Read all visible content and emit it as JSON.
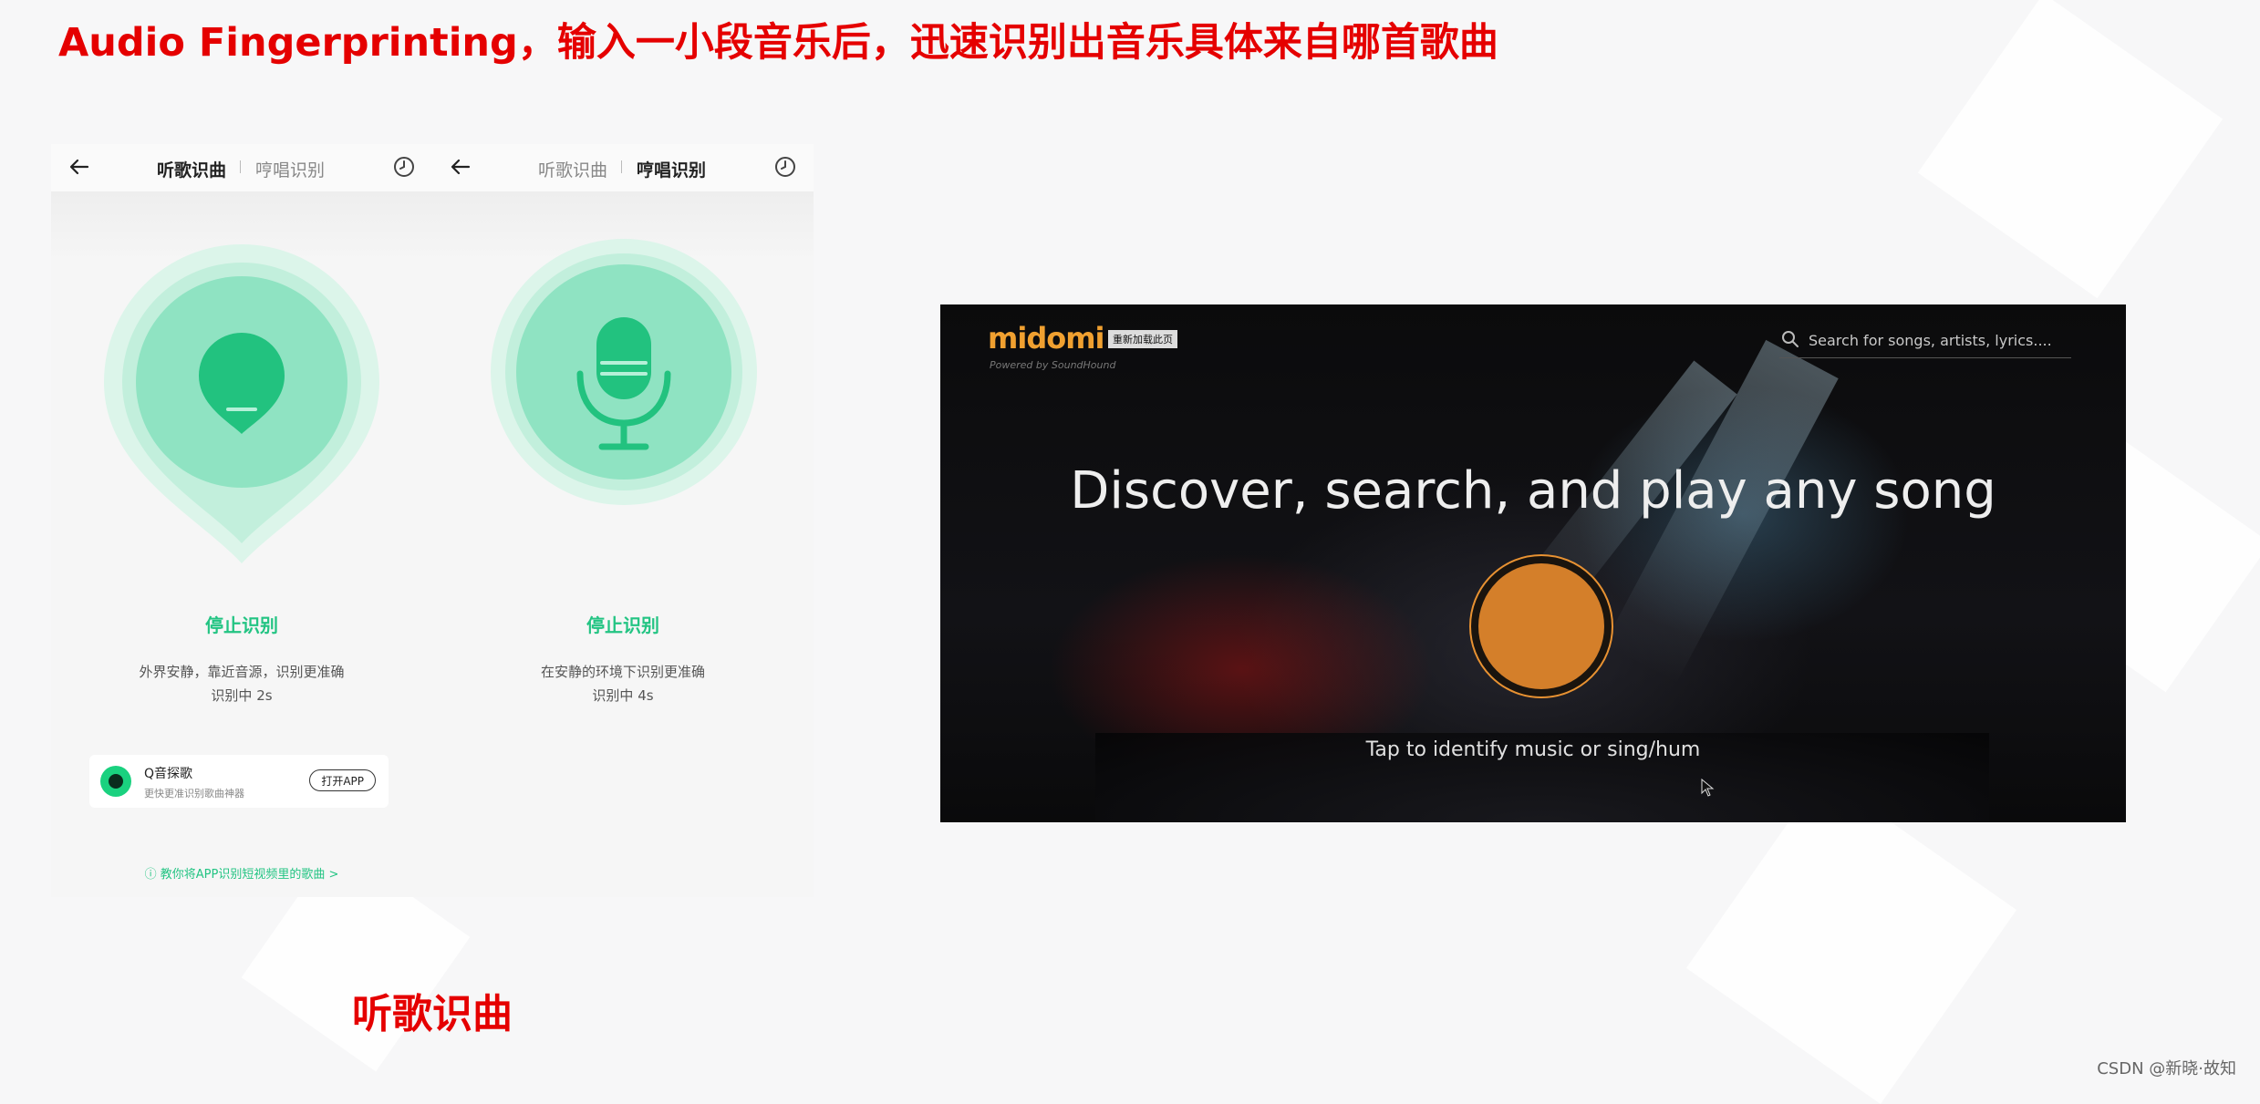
{
  "slide": {
    "title": "Audio Fingerprinting，输入一小段音乐后，迅速识别出音乐具体来自哪首歌曲",
    "caption": "听歌识曲",
    "watermark": "CSDN @新晓·故知"
  },
  "phone_listen": {
    "tabs": [
      "听歌识曲",
      "哼唱识别"
    ],
    "active_tab": "听歌识曲",
    "status": "停止识别",
    "hint_line1": "外界安静，靠近音源，识别更准确",
    "hint_line2": "识别中 2s",
    "app_card": {
      "name": "Q音探歌",
      "desc": "更快更准识别歌曲神器",
      "button": "打开APP"
    },
    "footer_link": "教你将APP识别短视频里的歌曲 >"
  },
  "phone_hum": {
    "tabs": [
      "听歌识曲",
      "哼唱识别"
    ],
    "active_tab": "哼唱识别",
    "status": "停止识别",
    "hint_line1": "在安静的环境下识别更准确",
    "hint_line2": "识别中 4s"
  },
  "midomi": {
    "logo": "midomi",
    "badge": "重新加载此页",
    "powered_by": "Powered by SoundHound",
    "search_placeholder": "Search for songs, artists, lyrics....",
    "headline": "Discover, search, and play any song",
    "tap_text": "Tap to identify music or sing/hum",
    "accent_color": "#d47f2a"
  },
  "colors": {
    "title_red": "#e50000",
    "green": "#23c483",
    "mint": "#96e6c8"
  }
}
